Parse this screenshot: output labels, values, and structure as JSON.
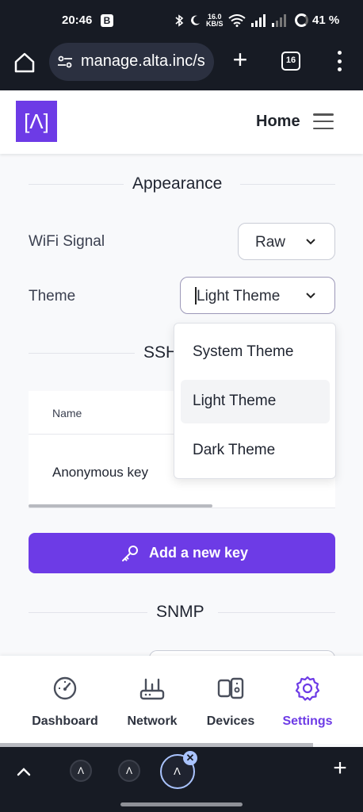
{
  "status_bar": {
    "time": "20:46",
    "badge": "B",
    "speed_top": "16.0",
    "speed_bottom": "KB/S",
    "battery": "41 %"
  },
  "browser": {
    "url": "manage.alta.inc/s",
    "tab_count": "16"
  },
  "header": {
    "logo_text": "[Λ]",
    "home_label": "Home",
    "brand_color": "#6d3be6"
  },
  "appearance": {
    "title": "Appearance",
    "wifi_label": "WiFi Signal",
    "wifi_value": "Raw",
    "theme_label": "Theme",
    "theme_value": "Light Theme"
  },
  "theme_options": [
    {
      "label": "System Theme",
      "selected": false
    },
    {
      "label": "Light Theme",
      "selected": true
    },
    {
      "label": "Dark Theme",
      "selected": false
    }
  ],
  "ssh": {
    "title": "SSH",
    "column_name": "Name",
    "row_name": "Anonymous key",
    "add_button": "Add a new key"
  },
  "snmp": {
    "title": "SNMP"
  },
  "bottom_nav": [
    {
      "label": "Dashboard",
      "icon": "gauge-icon",
      "active": false
    },
    {
      "label": "Network",
      "icon": "router-icon",
      "active": false
    },
    {
      "label": "Devices",
      "icon": "devices-icon",
      "active": false
    },
    {
      "label": "Settings",
      "icon": "gear-icon",
      "active": true
    }
  ],
  "tab_strip": {
    "close_symbol": "✕",
    "new_tab": "+"
  }
}
